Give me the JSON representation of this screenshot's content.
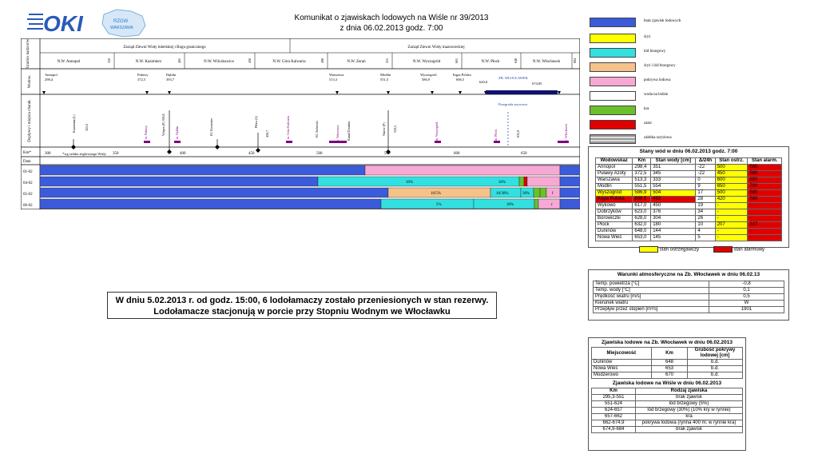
{
  "header": {
    "title_line1": "Komunikat o zjawiskach lodowych na Wiśle nr 39/2013",
    "title_line2": "z dnia 06.02.2013 godz. 7:00",
    "logo_left_text": "OKI",
    "logo_right_text": "RZGW WARSZAWA"
  },
  "grid": {
    "row_labels": {
      "granice": "Granice nadzorów",
      "wodow": "Wodow.",
      "doplywy": "Dopływy i miejsca charak.",
      "km": "Km*",
      "data": "Data"
    },
    "zarzad_left": "Zarząd Zlewni Wisły lubelskiej i Bugu granicznego",
    "zarzad_right": "Zarząd Zlewni Wisły mazowieckiej",
    "nadzory": [
      {
        "name": "N.W. Annopol",
        "km": "350"
      },
      {
        "name": "N.W. Kazimierz",
        "km": "405"
      },
      {
        "name": "N.W. Wilczkowice",
        "km": "456"
      },
      {
        "name": "N.W. Góra Kalwaria",
        "km": "498"
      },
      {
        "name": "N.W. Zerań",
        "km": "551"
      },
      {
        "name": "N.W. Wyszogród",
        "km": "601"
      },
      {
        "name": "N.W. Płock",
        "km": "646"
      },
      {
        "name": "N.W. Włocławek",
        "km": "684"
      }
    ],
    "wodowskazy": [
      {
        "name": "Annopol",
        "km": "298,4"
      },
      {
        "name": "Puławy",
        "km": "372,5"
      },
      {
        "name": "Dęblin",
        "km": "393,7"
      },
      {
        "name": "Warszawa",
        "km": "513,3"
      },
      {
        "name": "Modlin",
        "km": "551,5"
      },
      {
        "name": "Wyszogród",
        "km": "586,9"
      },
      {
        "name": "Kępa Polska",
        "km": "606,5"
      },
      {
        "name": "620,0",
        "km": ""
      },
      {
        "name": "ZB. WŁOCŁAWEK",
        "km": "674,85"
      }
    ],
    "doplywy": [
      "Kamienna (L)",
      "325,0",
      "m. Puławy",
      "Wieprz (P) 393,8",
      "m. Dęblin",
      "EC Kozienice",
      "Pilica (L)",
      "456,7",
      "m. Góra Kalwaria",
      "EC Siekierki",
      "m. Warszawa",
      "Kanał Żerański",
      "Narew (P)",
      "550,5",
      "m. Wyszogród",
      "m. Płock",
      "635,9",
      "m. Włocławek",
      "Przegroda szywowa"
    ],
    "km_ticks": [
      "300",
      "350",
      "400",
      "450",
      "500",
      "550",
      "600",
      "650"
    ],
    "km_note": "*wg szlaku żeglownego Wisły",
    "dates": [
      "01-02",
      "04-02",
      "05-02",
      "06-02"
    ],
    "bar_labels": {
      "r2a": "10%",
      "r2b": "30%",
      "r3a": "10/5%",
      "r3b": "10/30%",
      "r3c": "30%",
      "r3d": "f",
      "r4a": "5%",
      "r4b": "30%",
      "r4c": "r"
    }
  },
  "legend": [
    {
      "color": "#3b5bdb",
      "label": "brak zjawisk lodowych"
    },
    {
      "color": "#ffff00",
      "label": "śryż"
    },
    {
      "color": "#33e0e0",
      "label": "lód brzegowy"
    },
    {
      "color": "#f5c28a",
      "label": "śryż i lód brzegowy"
    },
    {
      "color": "#f7a8d4",
      "label": "pokrywa lodowa"
    },
    {
      "color": "#ffffff",
      "label": "woda na lodzie"
    },
    {
      "color": "#6abf2b",
      "label": "kra"
    },
    {
      "color": "#e00000",
      "label": "zator"
    },
    {
      "color": "#bbbbbb",
      "label": "zabitka szryżowa"
    }
  ],
  "stany": {
    "title": "Stany wód w dniu 06.02.2013 godz. 7:00",
    "headers": [
      "Wodowskaz",
      "Km",
      "Stan wody [cm]",
      "Δ/24h",
      "Stan ostrz.",
      "Stan alarm."
    ],
    "rows": [
      [
        "Annopol",
        "298,4",
        "351",
        "-22",
        "500",
        "580"
      ],
      [
        "Puławy Azoty",
        "372,5",
        "345",
        "-22",
        "450",
        "580"
      ],
      [
        "Warszawa",
        "513,3",
        "333",
        "0",
        "600",
        "650"
      ],
      [
        "Modlin",
        "551,5",
        "554",
        "9",
        "650",
        "700"
      ],
      [
        "Wyszogród",
        "586,9",
        "504",
        "17",
        "500",
        "580"
      ],
      [
        "Kępa Polska",
        "606,5",
        "492",
        "28",
        "420",
        "580"
      ],
      [
        "Wykowo",
        "617,0",
        "450",
        "19",
        "-",
        "-"
      ],
      [
        "Dobrzyków",
        "623,0",
        "376",
        "34",
        "-",
        "-"
      ],
      [
        "Borowiczki",
        "628,0",
        "304",
        "26",
        "-",
        "-"
      ],
      [
        "Płock",
        "632,0",
        "180",
        "10",
        "207",
        "337"
      ],
      [
        "Duninów",
        "648,0",
        "144",
        "4",
        "-",
        "-"
      ],
      [
        "Nowa Wieś",
        "653,0",
        "145",
        "5",
        "-",
        "-"
      ]
    ],
    "legend_ostrz": "stan ostrzegawczy",
    "legend_alarm": "stan alarmowy"
  },
  "notice": {
    "line1": "W dniu 5.02.2013 r. od godz. 15:00, 6 lodołamaczy zostało przeniesionych w stan rezerwy.",
    "line2": "Lodołamacze stacjonują w porcie przy Stopniu Wodnym we Włocławku"
  },
  "warunki": {
    "title": "Warunki atmosferyczne na Zb. Włocławek w dniu 06.02.13",
    "rows": [
      [
        "Temp. powietrza [°C]",
        "-0,8"
      ],
      [
        "Temp. wody [°C]",
        "0,1"
      ],
      [
        "Prędkość wiatru [m/s]",
        "0,5"
      ],
      [
        "Kierunek wiatru",
        "W"
      ],
      [
        "Przepływ przez stopień [m³/s]",
        "1901"
      ]
    ]
  },
  "zjawiska_zb": {
    "title": "Zjawiska lodowe na Zb. Włocławek w dniu 06.02.2013",
    "headers": [
      "Miejscowość",
      "Km",
      "Grubość pokrywy lodowej [cm]"
    ],
    "rows": [
      [
        "Duninów",
        "648",
        "b.d."
      ],
      [
        "Nowa Wieś",
        "653",
        "b.d."
      ],
      [
        "Modzerowo",
        "670",
        "b.d."
      ]
    ]
  },
  "zjawiska_wisla": {
    "title": "Zjawiska lodowe na Wiśle w dniu 06.02.2013",
    "headers": [
      "Km",
      "Rodzaj zjawiska"
    ],
    "rows": [
      [
        "295,3-551",
        "brak zjawisk"
      ],
      [
        "551-624",
        "lód brzegowy (5%)"
      ],
      [
        "624-657",
        "lód brzegowy (30%) (10% kry w rynnie)"
      ],
      [
        "657-662",
        "kra"
      ],
      [
        "662-674,9",
        "pokrywa lodowa (rynna 400 m; w rynnie kra)"
      ],
      [
        "674,9-684",
        "brak zjawisk"
      ]
    ]
  }
}
